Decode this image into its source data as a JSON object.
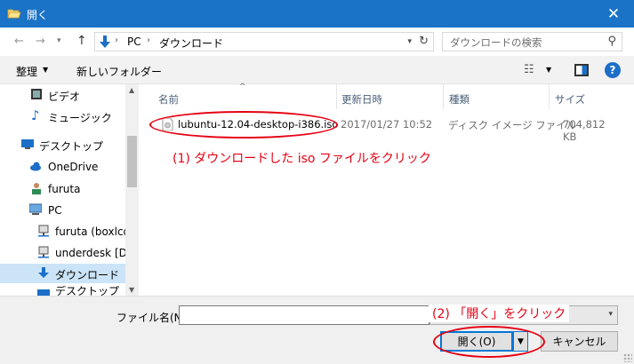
{
  "window": {
    "title": "開く",
    "close_glyph": "✕"
  },
  "address": {
    "crumbs": [
      "PC",
      "ダウンロード"
    ],
    "search_placeholder": "ダウンロードの検索"
  },
  "toolbar": {
    "organize": "整理",
    "new_folder": "新しいフォルダー",
    "help": "?"
  },
  "nav": {
    "items": [
      {
        "label": "ビデオ",
        "icon": "video-icon"
      },
      {
        "label": "ミュージック",
        "icon": "music-icon"
      },
      {
        "label": "デスクトップ",
        "icon": "desktop-icon"
      },
      {
        "label": "OneDrive",
        "icon": "onedrive-icon"
      },
      {
        "label": "furuta",
        "icon": "user-icon"
      },
      {
        "label": "PC",
        "icon": "pc-icon"
      },
      {
        "label": "furuta (boxlcd",
        "icon": "network-drive-icon"
      },
      {
        "label": "underdesk [Di",
        "icon": "network-drive-icon"
      },
      {
        "label": "ダウンロード",
        "icon": "download-icon",
        "selected": true
      },
      {
        "label": "デスクトップ",
        "icon": "desktop-icon"
      }
    ]
  },
  "columns": [
    "名前",
    "更新日時",
    "種類",
    "サイズ"
  ],
  "files": [
    {
      "name": "lubuntu-12.04-desktop-i386.iso",
      "date": "2017/01/27 10:52",
      "type": "ディスク イメージ ファイル",
      "size": "704,812 KB"
    }
  ],
  "annotations": {
    "step1": "(1) ダウンロードした iso ファイルをクリック",
    "step2": "(2) 「開く」をクリック"
  },
  "footer": {
    "filename_label": "ファイル名(N):",
    "filename_value": "",
    "open_label": "開く(O)",
    "cancel_label": "キャンセル"
  },
  "colors": {
    "titlebar": "#1a73c7",
    "accent": "#0078d7",
    "annotation": "#e60012",
    "selection": "#cce4f7"
  }
}
